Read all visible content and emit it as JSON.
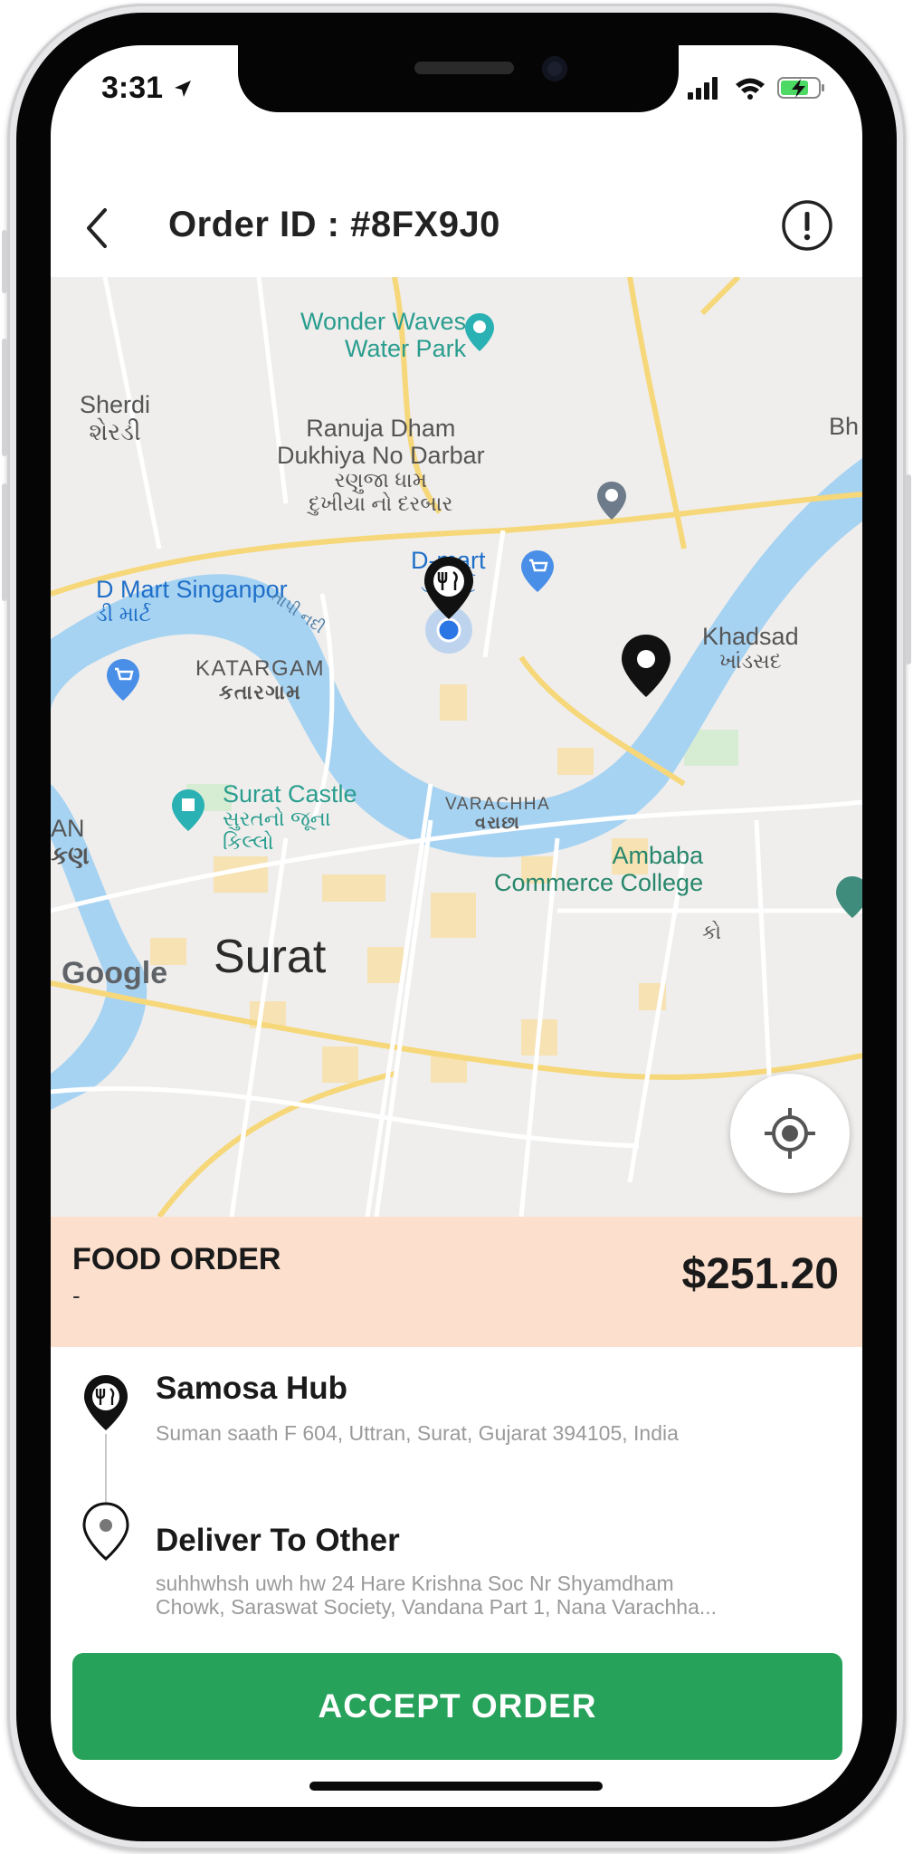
{
  "status_bar": {
    "time": "3:31"
  },
  "header": {
    "title": "Order ID : #8FX9J0"
  },
  "map": {
    "labels": {
      "wonder_waves": "Wonder Waves",
      "water_park": "Water Park",
      "sherdi": "Sherdi",
      "sherdi_gu": "શેરડી",
      "ranuja_dham": "Ranuja Dham",
      "dukhiya": "Dukhiya No Darbar",
      "ranuja_gu": "રણુજા ધામ",
      "dukhiya_gu": "દુખીયા નો દરબાર",
      "dmart": "D-mart",
      "dmart_gu": "ડી માર્ટ",
      "dmart_singanpor": "D Mart Singanpor",
      "dmart_singanpor_gu": "ડી માર્ટ",
      "tapi_river": "તાપી નદી",
      "katargam": "KATARGAM",
      "katargam_gu": "કતારગામ",
      "khadsad": "Khadsad",
      "khadsad_gu": "ખાંડસદ",
      "surat_castle": "Surat Castle",
      "surat_castle_gu1": "સુરતનો જૂના",
      "surat_castle_gu2": "કિલ્લો",
      "varachha": "VARACHHA",
      "varachha_gu": "વરાછા",
      "ambaba": "Ambaba",
      "commerce_college": "Commerce College",
      "surat": "Surat",
      "an": "AN",
      "an_gu": "કણ",
      "bh": "Bh",
      "ko": "કો",
      "google": "Google"
    }
  },
  "order": {
    "type_label": "FOOD ORDER",
    "sub_label": "-",
    "total": "$251.20"
  },
  "pickup": {
    "name": "Samosa Hub",
    "address": "Suman saath F 604, Uttran, Surat, Gujarat 394105, India"
  },
  "dropoff": {
    "name": "Deliver To Other",
    "address_line1": "suhhwhsh uwh hw  24 Hare Krishna Soc Nr Shyamdham",
    "address_line2": "Chowk, Saraswat Society, Vandana Part 1, Nana Varachha..."
  },
  "actions": {
    "accept_label": "ACCEPT ORDER"
  },
  "colors": {
    "accent_green": "#27a25a",
    "summary_bg": "#fcdfcd",
    "river": "#a7d3f2",
    "map_bg": "#efeeec"
  },
  "icons": [
    "back-arrow-icon",
    "info-icon",
    "restaurant-pin-icon",
    "location-pin-icon",
    "my-location-icon",
    "signal-icon",
    "wifi-icon",
    "battery-charging-icon",
    "location-arrow-icon"
  ]
}
